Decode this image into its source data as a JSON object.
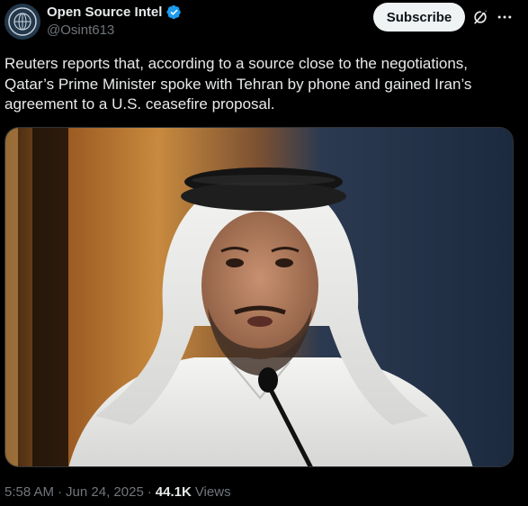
{
  "author": {
    "name": "Open Source Intel",
    "handle": "@Osint613",
    "verified": true,
    "avatar_icon": "globe-seal-icon"
  },
  "actions": {
    "subscribe_label": "Subscribe",
    "grok_icon": "grok-icon",
    "more_icon": "more-icon"
  },
  "tweet": {
    "text": "Reuters reports that, according to a source close to the negotiations,\nQatar’s Prime Minister spoke with Tehran by phone and gained Iran’s\nagreement to a U.S. ceasefire proposal."
  },
  "media": {
    "kind": "photo"
  },
  "meta": {
    "time": "5:58 AM",
    "separator1": "·",
    "date": "Jun 24, 2025",
    "separator2": "·",
    "views_count": "44.1K",
    "views_label": "Views"
  },
  "colors": {
    "background": "#000000",
    "text": "#e7e9ea",
    "secondary": "#71767b",
    "verified": "#1d9bf0",
    "subscribe_bg": "#eff3f4"
  }
}
